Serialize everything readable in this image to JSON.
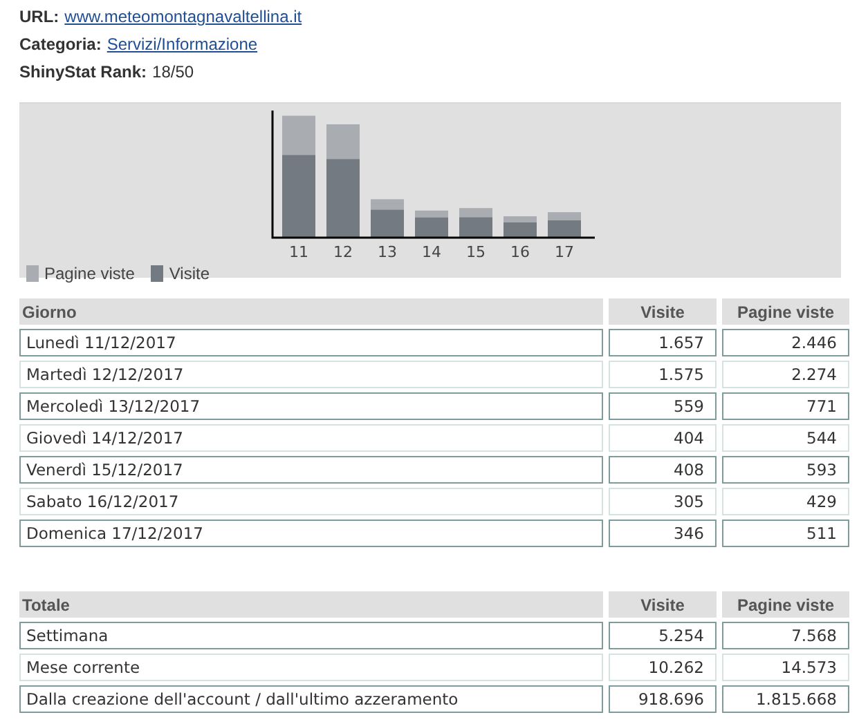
{
  "info": [
    {
      "label": "URL:",
      "value": "www.meteomontagnavaltellina.it",
      "kind": "link"
    },
    {
      "label": "Categoria:",
      "value": "Servizi/Informazione",
      "kind": "link"
    },
    {
      "label": "ShinyStat Rank:",
      "value": "18/50",
      "kind": "text"
    }
  ],
  "chart": {
    "axis_labels": [
      "11",
      "12",
      "13",
      "14",
      "15",
      "16",
      "17"
    ],
    "legend": [
      {
        "name": "Pagine viste",
        "color": "#a9adb1"
      },
      {
        "name": "Visite",
        "color": "#737a81"
      }
    ]
  },
  "tables": [
    {
      "columns": [
        "Giorno",
        "Visite",
        "Pagine viste"
      ],
      "rows": [
        [
          "Lunedì 11/12/2017",
          "1.657",
          "2.446"
        ],
        [
          "Martedì 12/12/2017",
          "1.575",
          "2.274"
        ],
        [
          "Mercoledì 13/12/2017",
          "559",
          "771"
        ],
        [
          "Giovedì 14/12/2017",
          "404",
          "544"
        ],
        [
          "Venerdì 15/12/2017",
          "408",
          "593"
        ],
        [
          "Sabato 16/12/2017",
          "305",
          "429"
        ],
        [
          "Domenica 17/12/2017",
          "346",
          "511"
        ]
      ]
    },
    {
      "columns": [
        "Totale",
        "Visite",
        "Pagine viste"
      ],
      "rows": [
        [
          "Settimana",
          "5.254",
          "7.568"
        ],
        [
          "Mese corrente",
          "10.262",
          "14.573"
        ],
        [
          "Dalla creazione dell'account / dall'ultimo azzeramento",
          "918.696",
          "1.815.668"
        ]
      ]
    }
  ]
}
